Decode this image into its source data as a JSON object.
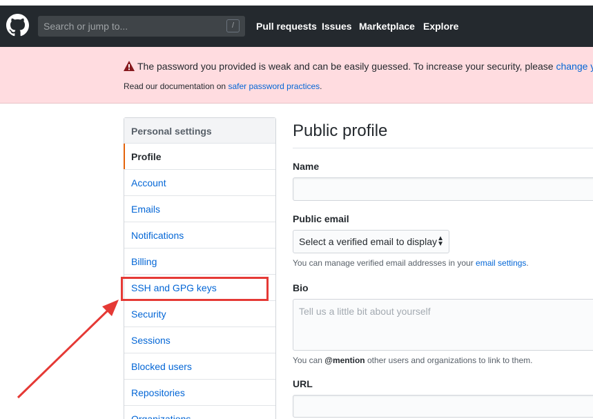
{
  "header": {
    "search_placeholder": "Search or jump to...",
    "search_shortcut": "/",
    "nav": [
      "Pull requests",
      "Issues",
      "Marketplace",
      "Explore"
    ]
  },
  "flash": {
    "message": "The password you provided is weak and can be easily guessed. To increase your security, please ",
    "message_link": "change your",
    "doc_prefix": "Read our documentation on ",
    "doc_link": "safer password practices",
    "doc_suffix": "."
  },
  "sidebar": {
    "heading": "Personal settings",
    "items": [
      {
        "label": "Profile"
      },
      {
        "label": "Account"
      },
      {
        "label": "Emails"
      },
      {
        "label": "Notifications"
      },
      {
        "label": "Billing"
      },
      {
        "label": "SSH and GPG keys"
      },
      {
        "label": "Security"
      },
      {
        "label": "Sessions"
      },
      {
        "label": "Blocked users"
      },
      {
        "label": "Repositories"
      },
      {
        "label": "Organizations"
      }
    ],
    "selected": "Profile",
    "annotated_item": "SSH and GPG keys"
  },
  "main": {
    "title": "Public profile",
    "name_label": "Name",
    "name_value": "",
    "email_label": "Public email",
    "email_select": "Select a verified email to display",
    "email_note_prefix": "You can manage verified email addresses in your ",
    "email_note_link": "email settings",
    "email_note_suffix": ".",
    "bio_label": "Bio",
    "bio_placeholder": "Tell us a little bit about yourself",
    "bio_note_prefix": "You can ",
    "bio_note_mention": "@mention",
    "bio_note_suffix": " other users and organizations to link to them.",
    "url_label": "URL",
    "url_value": ""
  },
  "colors": {
    "header_bg": "#24292e",
    "flash_bg": "#ffdce0",
    "link": "#0366d6",
    "selected_marker": "#e36209",
    "annotation": "#e53935"
  }
}
